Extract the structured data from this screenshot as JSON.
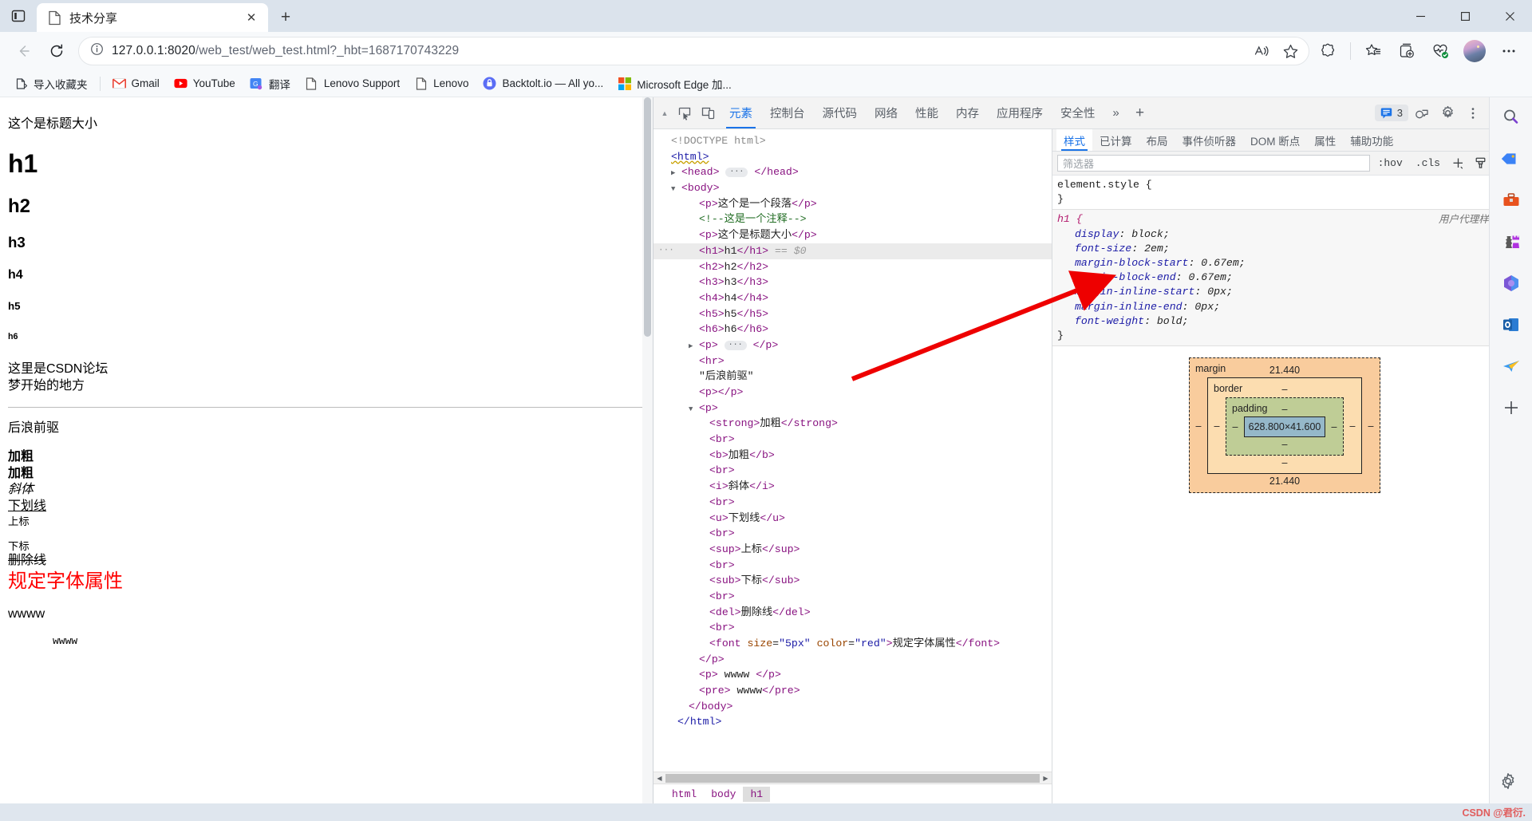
{
  "browser": {
    "tab": {
      "title": "技术分享",
      "close_label": "✕"
    },
    "new_tab_label": "+",
    "window": {
      "minimize": "—",
      "maximize": "▢",
      "close": "✕"
    },
    "address": {
      "url_host": "127.0.0.1:8020",
      "url_path": "/web_test/web_test.html?_hbt=1687170743229",
      "info_icon": "info-icon",
      "read_aloud_icon": "read-aloud-icon",
      "favorite_icon": "star-icon"
    },
    "toolbar_icons": [
      "back-arrow-icon",
      "refresh-icon",
      "copilot-icon",
      "collections-icon",
      "add-tab-group-icon",
      "browser-essentials-icon",
      "profile-avatar",
      "settings-more-icon"
    ],
    "bookmarks": [
      {
        "label": "导入收藏夹",
        "icon": "import-favorites-icon"
      },
      {
        "label": "Gmail",
        "icon": "gmail-icon"
      },
      {
        "label": "YouTube",
        "icon": "youtube-icon"
      },
      {
        "label": "翻译",
        "icon": "translate-icon"
      },
      {
        "label": "Lenovo Support",
        "icon": "page-icon"
      },
      {
        "label": "Lenovo",
        "icon": "page-icon"
      },
      {
        "label": "Backtolt.io — All yo...",
        "icon": "backtolt-icon"
      },
      {
        "label": "Microsoft Edge 加...",
        "icon": "microsoft-icon"
      }
    ]
  },
  "page_content": {
    "p_title": "这个是标题大小",
    "h1": "h1",
    "h2": "h2",
    "h3": "h3",
    "h4": "h4",
    "h5": "h5",
    "h6": "h6",
    "p_line1": "这里是CSDN论坛",
    "p_line2": "梦开始的地方",
    "quote": "后浪前驱",
    "strong": "加粗",
    "bold": "加粗",
    "italic": "斜体",
    "underline": "下划线",
    "sup": "上标",
    "sub": "下标",
    "del": "删除线",
    "font_red": "规定字体属性",
    "p_wwww": "wwww",
    "pre_wwww": "wwww"
  },
  "devtools": {
    "tabs": [
      {
        "label": "元素",
        "active": true
      },
      {
        "label": "控制台",
        "active": false
      },
      {
        "label": "源代码",
        "active": false
      },
      {
        "label": "网络",
        "active": false
      },
      {
        "label": "性能",
        "active": false
      },
      {
        "label": "内存",
        "active": false
      },
      {
        "label": "应用程序",
        "active": false
      },
      {
        "label": "安全性",
        "active": false
      }
    ],
    "more_tabs_label": "»",
    "add_tab_label": "+",
    "issues_count": "3",
    "toolbar_icons": [
      "inspect-element-icon",
      "device-toolbar-icon",
      "issues-icon",
      "cloud-devtools-icon",
      "devtools-settings-icon",
      "devtools-more-icon",
      "devtools-close-icon"
    ],
    "dom_lines": [
      {
        "indent": 0,
        "twisty": "",
        "html": "doctype",
        "text": "<!DOCTYPE html>"
      },
      {
        "indent": 0,
        "twisty": "",
        "html": "html_open",
        "text": "<html>"
      },
      {
        "indent": 1,
        "twisty": "▶",
        "html": "head",
        "text": "<head> … </head>"
      },
      {
        "indent": 1,
        "twisty": "▼",
        "html": "body_open",
        "text": "<body>"
      },
      {
        "indent": 2,
        "twisty": "",
        "html": "p1",
        "text": "<p>这个是一个段落</p>"
      },
      {
        "indent": 2,
        "twisty": "",
        "html": "comment",
        "text": "<!--这是一个注释-->"
      },
      {
        "indent": 2,
        "twisty": "",
        "html": "p2",
        "text": "<p>这个是标题大小</p>"
      },
      {
        "indent": 2,
        "twisty": "",
        "html": "h1",
        "text": "<h1>h1</h1> == $0",
        "selected": true
      },
      {
        "indent": 2,
        "twisty": "",
        "html": "h2",
        "text": "<h2>h2</h2>"
      },
      {
        "indent": 2,
        "twisty": "",
        "html": "h3",
        "text": "<h3>h3</h3>"
      },
      {
        "indent": 2,
        "twisty": "",
        "html": "h4",
        "text": "<h4>h4</h4>"
      },
      {
        "indent": 2,
        "twisty": "",
        "html": "h5",
        "text": "<h5>h5</h5>"
      },
      {
        "indent": 2,
        "twisty": "",
        "html": "h6",
        "text": "<h6>h6</h6>"
      },
      {
        "indent": 1,
        "twisty": "▶",
        "html": "p3",
        "text": "<p> … </p>"
      },
      {
        "indent": 2,
        "twisty": "",
        "html": "hr",
        "text": "<hr>"
      },
      {
        "indent": 2,
        "twisty": "",
        "html": "quote",
        "text": "\"后浪前驱\""
      },
      {
        "indent": 2,
        "twisty": "",
        "html": "p4",
        "text": "<p></p>"
      },
      {
        "indent": 1,
        "twisty": "▼",
        "html": "p5",
        "text": "<p>"
      },
      {
        "indent": 3,
        "twisty": "",
        "html": "strong",
        "text": "<strong>加粗</strong>"
      },
      {
        "indent": 3,
        "twisty": "",
        "html": "br1",
        "text": "<br>"
      },
      {
        "indent": 3,
        "twisty": "",
        "html": "b",
        "text": "<b>加粗</b>"
      },
      {
        "indent": 3,
        "twisty": "",
        "html": "br2",
        "text": "<br>"
      },
      {
        "indent": 3,
        "twisty": "",
        "html": "i",
        "text": "<i>斜体</i>"
      },
      {
        "indent": 3,
        "twisty": "",
        "html": "br3",
        "text": "<br>"
      },
      {
        "indent": 3,
        "twisty": "",
        "html": "u",
        "text": "<u>下划线</u>"
      },
      {
        "indent": 3,
        "twisty": "",
        "html": "br4",
        "text": "<br>"
      },
      {
        "indent": 3,
        "twisty": "",
        "html": "sup",
        "text": "<sup>上标</sup>"
      },
      {
        "indent": 3,
        "twisty": "",
        "html": "br5",
        "text": "<br>"
      },
      {
        "indent": 3,
        "twisty": "",
        "html": "sub",
        "text": "<sub>下标</sub>"
      },
      {
        "indent": 3,
        "twisty": "",
        "html": "br6",
        "text": "<br>"
      },
      {
        "indent": 3,
        "twisty": "",
        "html": "del",
        "text": "<del>删除线</del>"
      },
      {
        "indent": 3,
        "twisty": "",
        "html": "br7",
        "text": "<br>"
      },
      {
        "indent": 3,
        "twisty": "",
        "html": "font",
        "text": "<font size=\"5px\" color=\"red\">规定字体属性</font>"
      },
      {
        "indent": 2,
        "twisty": "",
        "html": "p5close",
        "text": "</p>"
      },
      {
        "indent": 2,
        "twisty": "",
        "html": "p6",
        "text": "<p> wwww </p>"
      },
      {
        "indent": 2,
        "twisty": "",
        "html": "pre",
        "text": "<pre> wwww</pre>"
      },
      {
        "indent": 1,
        "twisty": "",
        "html": "bodyclose",
        "text": "</body>"
      },
      {
        "indent": 0,
        "twisty": "",
        "html": "htmlclose",
        "text": "</html>"
      }
    ],
    "breadcrumb": [
      {
        "label": "html",
        "active": false
      },
      {
        "label": "body",
        "active": false
      },
      {
        "label": "h1",
        "active": true
      }
    ],
    "styles": {
      "tabs": [
        {
          "label": "样式",
          "active": true
        },
        {
          "label": "已计算",
          "active": false
        },
        {
          "label": "布局",
          "active": false
        },
        {
          "label": "事件侦听器",
          "active": false
        },
        {
          "label": "DOM 断点",
          "active": false
        },
        {
          "label": "属性",
          "active": false
        },
        {
          "label": "辅助功能",
          "active": false
        }
      ],
      "filter_placeholder": "筛选器",
      "hov_label": ":hov",
      "cls_label": ".cls",
      "new_rule_label": "+",
      "rules": [
        {
          "selector": "element.style {",
          "closing": "}",
          "origin": "",
          "declarations": []
        },
        {
          "selector": "h1 {",
          "closing": "}",
          "origin": "用户代理样式表",
          "declarations": [
            {
              "prop": "display",
              "value": "block"
            },
            {
              "prop": "font-size",
              "value": "2em"
            },
            {
              "prop": "margin-block-start",
              "value": "0.67em"
            },
            {
              "prop": "margin-block-end",
              "value": "0.67em"
            },
            {
              "prop": "margin-inline-start",
              "value": "0px"
            },
            {
              "prop": "margin-inline-end",
              "value": "0px"
            },
            {
              "prop": "font-weight",
              "value": "bold"
            }
          ]
        }
      ],
      "box_model": {
        "margin_label": "margin",
        "margin_top": "21.440",
        "margin_bottom": "21.440",
        "margin_left": "–",
        "margin_right": "–",
        "border_label": "border",
        "border_top": "–",
        "border_bottom": "–",
        "border_left": "–",
        "border_right": "–",
        "padding_label": "padding",
        "padding_top": "–",
        "padding_bottom": "–",
        "padding_left": "–",
        "padding_right": "–",
        "content_size": "628.800×41.600"
      }
    }
  },
  "edge_sidebar": {
    "icons": [
      {
        "name": "search-icon",
        "glyph": "🔍"
      },
      {
        "name": "shopping-tag-icon",
        "glyph": "🏷"
      },
      {
        "name": "toolbox-icon",
        "glyph": "🧰"
      },
      {
        "name": "games-icon",
        "glyph": "♟"
      },
      {
        "name": "microsoft-365-icon",
        "glyph": "◈"
      },
      {
        "name": "outlook-icon",
        "glyph": "📧"
      },
      {
        "name": "outlook-send-icon",
        "glyph": "✈"
      },
      {
        "name": "add-sidebar-icon",
        "glyph": "+"
      }
    ],
    "settings_icon": "gear-icon"
  },
  "watermark": {
    "text": "CSDN @君衍."
  },
  "colors": {
    "accent": "#1a73e8",
    "selector": "#b31b6e",
    "tag": "#881280",
    "attr_value": "#1a1aa6",
    "comment": "#236e25",
    "arrow_red": "#ee0000",
    "box_margin": "#f9cc9d",
    "box_border": "#fcddb0",
    "box_padding": "#bfcd96",
    "box_content": "#95b8c9"
  }
}
